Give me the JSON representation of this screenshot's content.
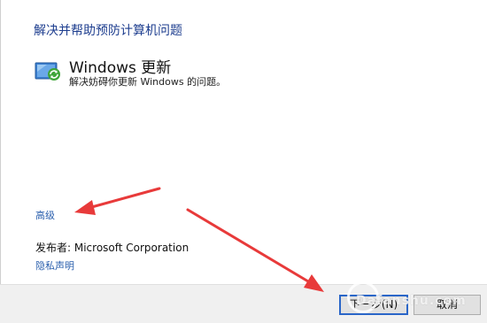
{
  "dialog": {
    "title": "解决并帮助预防计算机问题"
  },
  "troubleshooter": {
    "icon": "windows-update-icon",
    "title": "Windows 更新",
    "description": "解决妨碍你更新 Windows 的问题。"
  },
  "links": {
    "advanced": "高级",
    "privacy": "隐私声明"
  },
  "publisher": {
    "label": "发布者:  Microsoft Corporation"
  },
  "buttons": {
    "next": "下一步(N)",
    "cancel": "取消"
  },
  "watermark": {
    "text": "Dafanshu.com"
  },
  "colors": {
    "title": "#1e3e8f",
    "link": "#2a5fad",
    "annotation_arrow": "#e83a3a",
    "default_button_border": "#2a66c8"
  }
}
